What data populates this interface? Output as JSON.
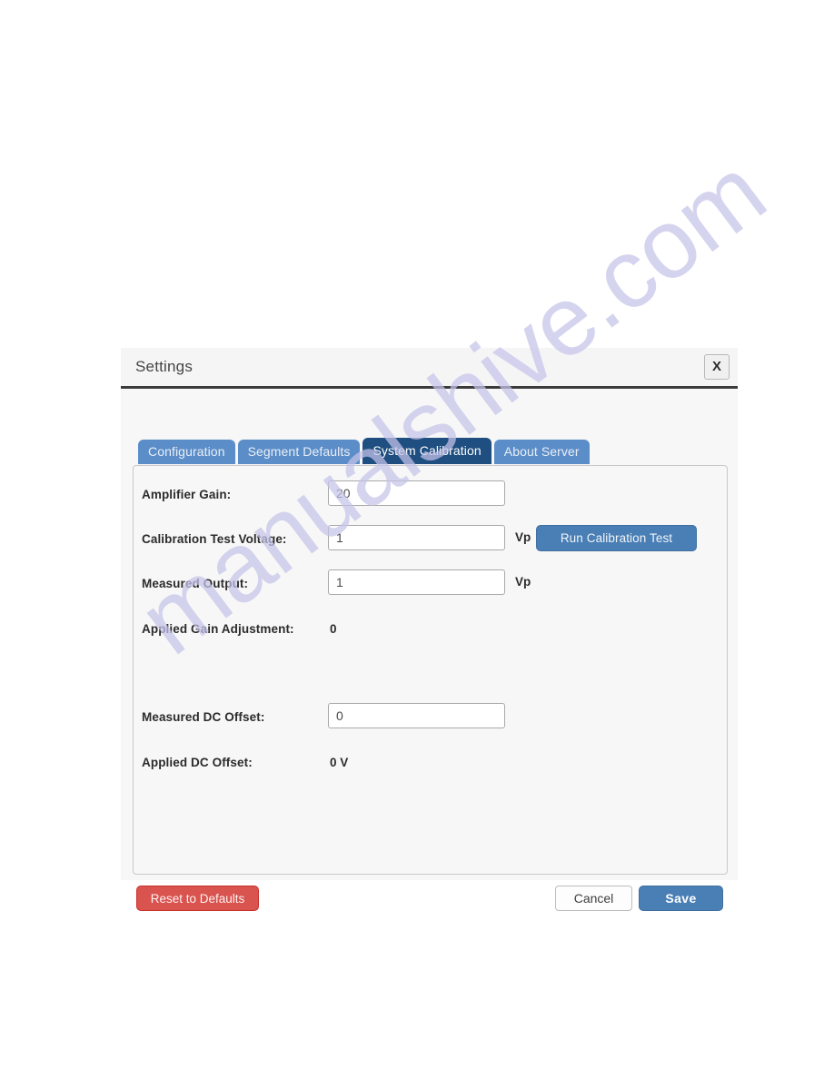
{
  "watermark": {
    "text": "manualshive.com",
    "color": "#c6c4ea"
  },
  "dialog": {
    "title": "Settings",
    "close_label": "X",
    "tabs": [
      {
        "label": "Configuration",
        "active": false
      },
      {
        "label": "Segment Defaults",
        "active": false
      },
      {
        "label": "System Calibration",
        "active": true
      },
      {
        "label": "About Server",
        "active": false
      }
    ],
    "fields": [
      {
        "label": "Amplifier Gain:",
        "type": "input",
        "value": "20",
        "placeholder": "",
        "unit": ""
      },
      {
        "label": "Calibration Test Voltage:",
        "type": "input",
        "value": "1",
        "placeholder": "",
        "unit": "Vp",
        "action_label": "Run Calibration Test"
      },
      {
        "label": "Measured Output:",
        "type": "input",
        "value": "1",
        "placeholder": "",
        "unit": "Vp"
      },
      {
        "label": "Applied Gain Adjustment:",
        "type": "static",
        "value": "0"
      },
      {
        "label": "Measured DC Offset:",
        "type": "input",
        "value": "0",
        "placeholder": "",
        "unit": ""
      },
      {
        "label": "Applied DC Offset:",
        "type": "static",
        "value": "0 V"
      }
    ],
    "footer": {
      "reset_label": "Reset to Defaults",
      "cancel_label": "Cancel",
      "save_label": "Save"
    },
    "colors": {
      "accent_blue": "#4a7fb5",
      "tab_active": "#1f4e80",
      "tab_inactive": "#5b8dc8",
      "danger_red": "#d9534f",
      "panel_bg": "#f7f7f7"
    }
  }
}
